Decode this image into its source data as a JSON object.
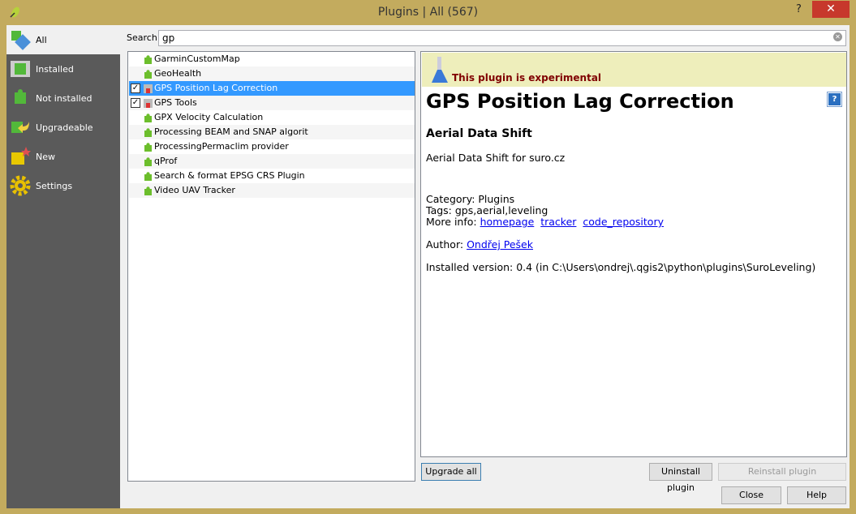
{
  "window": {
    "title": "Plugins | All (567)",
    "help": "?",
    "close": "✕"
  },
  "sidebar": {
    "items": [
      {
        "label": "All",
        "icon": "puzzle-all-icon"
      },
      {
        "label": "Installed",
        "icon": "puzzle-installed-icon"
      },
      {
        "label": "Not installed",
        "icon": "puzzle-not-installed-icon"
      },
      {
        "label": "Upgradeable",
        "icon": "puzzle-upgrade-icon"
      },
      {
        "label": "New",
        "icon": "puzzle-new-icon"
      },
      {
        "label": "Settings",
        "icon": "gear-icon"
      }
    ]
  },
  "search": {
    "label": "Search",
    "value": "gp"
  },
  "plugins": [
    {
      "name": "GarminCustomMap",
      "checked": false
    },
    {
      "name": "GeoHealth",
      "checked": false
    },
    {
      "name": "GPS Position Lag Correction",
      "checked": true,
      "selected": true
    },
    {
      "name": "GPS Tools",
      "checked": true
    },
    {
      "name": "GPX Velocity Calculation",
      "checked": false
    },
    {
      "name": "Processing BEAM and SNAP algorit",
      "checked": false
    },
    {
      "name": "ProcessingPermaclim provider",
      "checked": false
    },
    {
      "name": "qProf",
      "checked": false
    },
    {
      "name": "Search & format EPSG CRS Plugin",
      "checked": false
    },
    {
      "name": "Video UAV Tracker",
      "checked": false
    }
  ],
  "detail": {
    "experimental": "This plugin is experimental",
    "title": "GPS Position Lag Correction",
    "subtitle": "Aerial Data Shift",
    "description": "Aerial Data Shift for suro.cz",
    "category": "Category: Plugins",
    "tags": "Tags: gps,aerial,leveling",
    "more_info_label": "More info:",
    "links": {
      "homepage": "homepage",
      "tracker": "tracker",
      "repo": "code_repository"
    },
    "author_label": "Author:",
    "author": "Ondřej Pešek",
    "installed": "Installed version: 0.4 (in C:\\Users\\ondrej\\.qgis2\\python\\plugins\\SuroLeveling)"
  },
  "buttons": {
    "upgrade_all": "Upgrade all",
    "uninstall": "Uninstall plugin",
    "reinstall": "Reinstall plugin",
    "close": "Close",
    "help": "Help"
  }
}
